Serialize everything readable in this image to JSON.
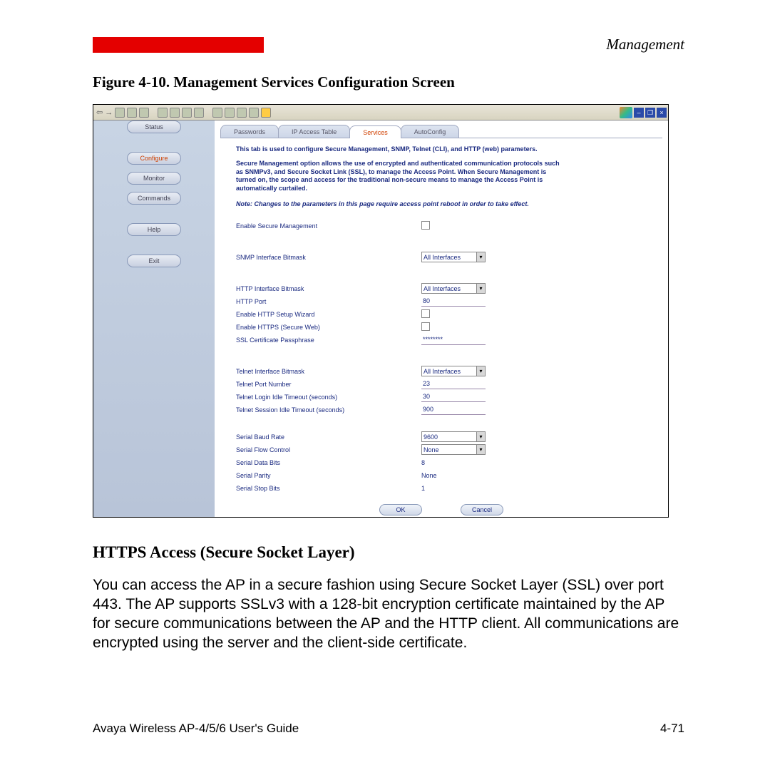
{
  "header": {
    "section_title": "Management"
  },
  "figure": {
    "caption": "Figure 4-10.   Management Services Configuration Screen"
  },
  "sidebar": {
    "items": [
      {
        "label": "Status"
      },
      {
        "label": "Configure"
      },
      {
        "label": "Monitor"
      },
      {
        "label": "Commands"
      },
      {
        "label": "Help"
      },
      {
        "label": "Exit"
      }
    ]
  },
  "tabs": [
    {
      "label": "Passwords"
    },
    {
      "label": "IP Access Table"
    },
    {
      "label": "Services"
    },
    {
      "label": "AutoConfig"
    }
  ],
  "intro": {
    "line1": "This tab is used to configure Secure Management, SNMP, Telnet (CLI), and HTTP (web) parameters.",
    "para": "Secure Management option allows the use of encrypted and authenticated communication protocols such as SNMPv3, and Secure Socket Link (SSL), to manage the Access Point. When Secure Management is turned on, the scope and access for the traditional non-secure means to manage the Access Point is automatically curtailed.",
    "note": "Note: Changes to the parameters in this page require access point reboot in order to take effect."
  },
  "form": {
    "enable_secure_mgmt": "Enable Secure Management",
    "snmp_bitmask_label": "SNMP Interface Bitmask",
    "snmp_bitmask_value": "All Interfaces",
    "http_bitmask_label": "HTTP Interface Bitmask",
    "http_bitmask_value": "All Interfaces",
    "http_port_label": "HTTP Port",
    "http_port_value": "80",
    "http_wizard_label": "Enable HTTP Setup Wizard",
    "https_label": "Enable HTTPS (Secure Web)",
    "ssl_pass_label": "SSL Certificate Passphrase",
    "ssl_pass_value": "********",
    "telnet_bitmask_label": "Telnet Interface Bitmask",
    "telnet_bitmask_value": "All Interfaces",
    "telnet_port_label": "Telnet Port Number",
    "telnet_port_value": "23",
    "telnet_login_timeout_label": "Telnet Login Idle Timeout (seconds)",
    "telnet_login_timeout_value": "30",
    "telnet_session_timeout_label": "Telnet Session Idle Timeout (seconds)",
    "telnet_session_timeout_value": "900",
    "serial_baud_label": "Serial Baud Rate",
    "serial_baud_value": "9600",
    "serial_flow_label": "Serial Flow Control",
    "serial_flow_value": "None",
    "serial_data_bits_label": "Serial Data Bits",
    "serial_data_bits_value": "8",
    "serial_parity_label": "Serial Parity",
    "serial_parity_value": "None",
    "serial_stop_bits_label": "Serial Stop Bits",
    "serial_stop_bits_value": "1"
  },
  "buttons": {
    "ok": "OK",
    "cancel": "Cancel"
  },
  "section": {
    "heading": "HTTPS Access (Secure Socket Layer)",
    "body": "You can access the AP in a secure fashion using Secure Socket Layer (SSL) over port 443. The AP supports SSLv3 with a 128-bit encryption certificate maintained by the AP for secure communications between the AP and the HTTP client. All communications are encrypted using the server and the client-side certificate."
  },
  "footer": {
    "left": "Avaya Wireless AP-4/5/6 User's Guide",
    "right": "4-71"
  }
}
